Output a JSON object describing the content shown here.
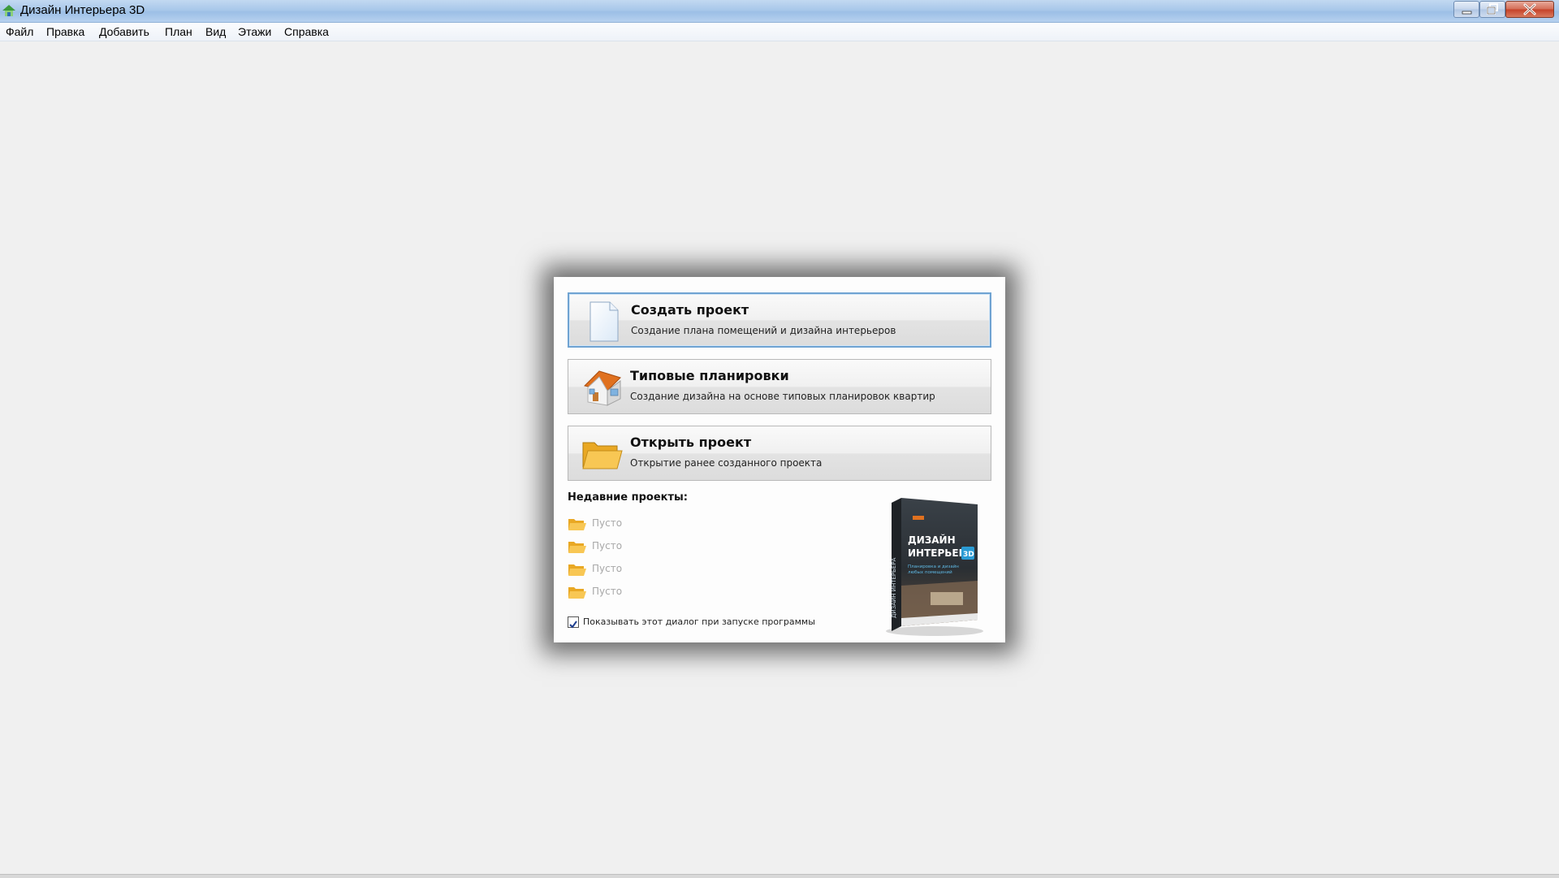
{
  "window": {
    "title": "Дизайн Интерьера 3D"
  },
  "menu": {
    "items": [
      "Файл",
      "Правка",
      "Добавить",
      "План",
      "Вид",
      "Этажи",
      "Справка"
    ]
  },
  "dialog": {
    "actions": [
      {
        "title": "Создать проект",
        "description": "Создание плана помещений и дизайна интерьеров",
        "icon": "new-document-icon"
      },
      {
        "title": "Типовые планировки",
        "description": "Создание дизайна на основе типовых планировок квартир",
        "icon": "house-icon"
      },
      {
        "title": "Открыть проект",
        "description": "Открытие ранее созданного проекта",
        "icon": "open-folder-icon"
      }
    ],
    "recent_title": "Недавние проекты:",
    "recent_items": [
      "Пусто",
      "Пусто",
      "Пусто",
      "Пусто"
    ],
    "show_on_startup_label": "Показывать этот диалог при запуске программы",
    "show_on_startup_checked": true,
    "product_box": {
      "title_line1": "ДИЗАЙН",
      "title_line2": "ИНТЕРЬЕРА",
      "badge": "3D",
      "subtitle_line1": "Планировка и дизайн",
      "subtitle_line2": "любых помещений",
      "side_text": "ДИЗАЙН ИНТЕРЬЕРА"
    }
  },
  "colors": {
    "titlebar": "#a9c8ea",
    "selected_border": "#6fa3d2",
    "folder": "#f1b53a",
    "house_roof": "#e0711f"
  }
}
